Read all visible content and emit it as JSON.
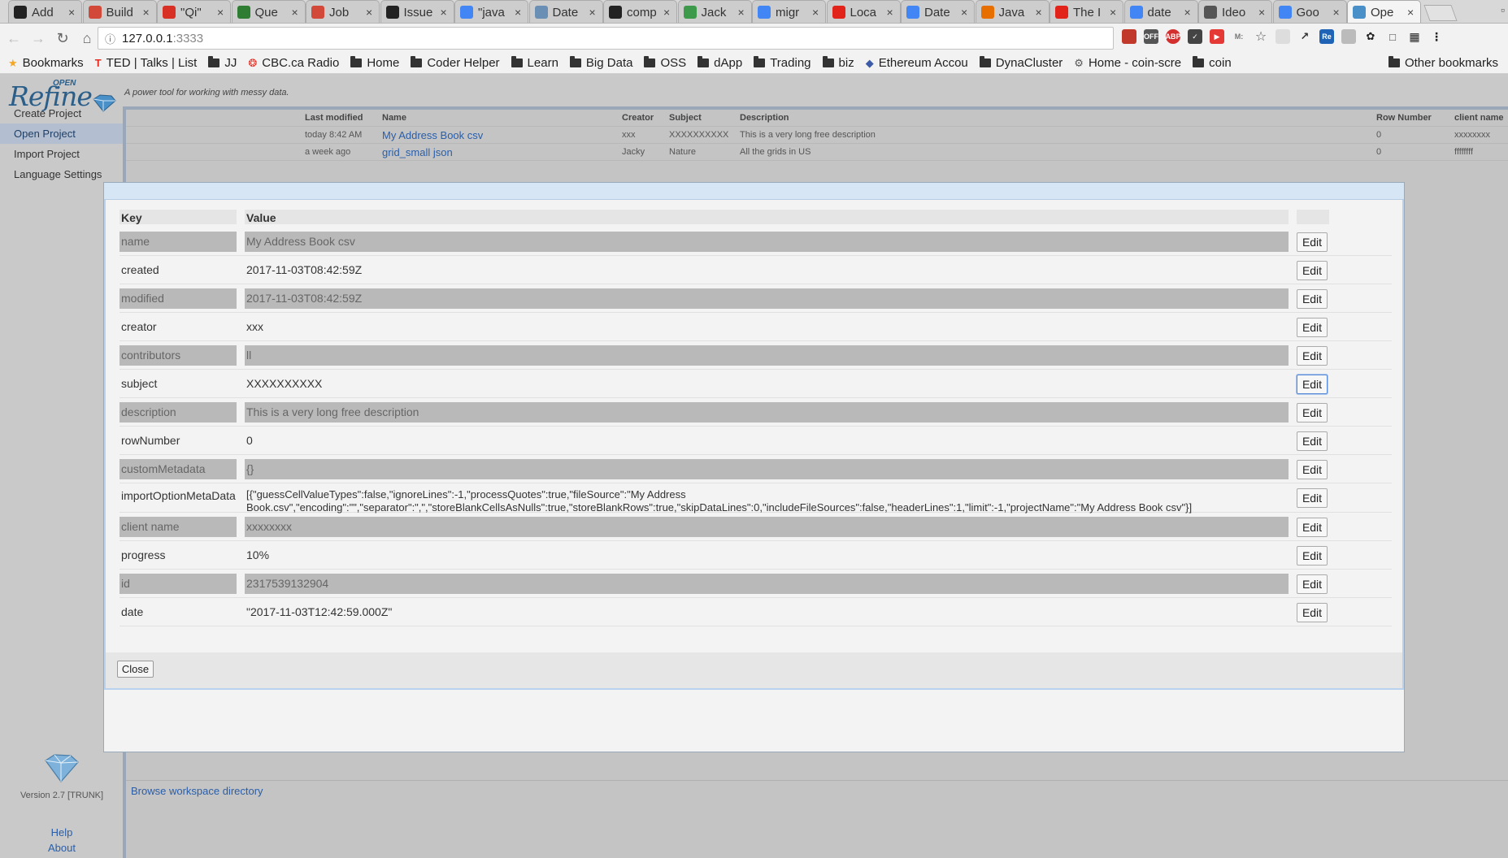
{
  "browser": {
    "tabs": [
      {
        "title": "Add",
        "icon": "github-icon",
        "color": "#222222"
      },
      {
        "title": "Build",
        "icon": "jenkins-icon",
        "color": "#d24939"
      },
      {
        "title": "\"Qi\"",
        "icon": "gmail-icon",
        "color": "#d93025"
      },
      {
        "title": "Que",
        "icon": "sheets-icon",
        "color": "#2e7d32"
      },
      {
        "title": "Job",
        "icon": "jenkins-icon",
        "color": "#d24939"
      },
      {
        "title": "Issue",
        "icon": "github-icon",
        "color": "#222222"
      },
      {
        "title": "\"java",
        "icon": "google-icon",
        "color": "#4285f4"
      },
      {
        "title": "Date",
        "icon": "doc-icon",
        "color": "#6a8fb5"
      },
      {
        "title": "comp",
        "icon": "github-icon",
        "color": "#222222"
      },
      {
        "title": "Jack",
        "icon": "leaf-icon",
        "color": "#3c9a4a"
      },
      {
        "title": "migr",
        "icon": "google-icon",
        "color": "#4285f4"
      },
      {
        "title": "Loca",
        "icon": "oracle-icon",
        "color": "#e2231a"
      },
      {
        "title": "Date",
        "icon": "google-icon",
        "color": "#4285f4"
      },
      {
        "title": "Java",
        "icon": "java-icon",
        "color": "#e76f00"
      },
      {
        "title": "The I",
        "icon": "oracle-icon",
        "color": "#e2231a"
      },
      {
        "title": "date",
        "icon": "google-icon",
        "color": "#4285f4"
      },
      {
        "title": "Ideo",
        "icon": "ideone-icon",
        "color": "#555555"
      },
      {
        "title": "Goo",
        "icon": "google-icon",
        "color": "#4285f4"
      },
      {
        "title": "Ope",
        "icon": "openrefine-icon",
        "color": "#4a90c8",
        "active": true
      }
    ],
    "url_host": "127.0.0.1",
    "url_port": ":3333",
    "bookmarks": [
      {
        "label": "Bookmarks",
        "icon": "star-icon"
      },
      {
        "label": "TED | Talks | List",
        "icon": "ted-icon"
      },
      {
        "label": "JJ",
        "icon": "folder-icon"
      },
      {
        "label": "CBC.ca Radio",
        "icon": "cbc-icon"
      },
      {
        "label": "Home",
        "icon": "folder-icon"
      },
      {
        "label": "Coder Helper",
        "icon": "folder-icon"
      },
      {
        "label": "Learn",
        "icon": "folder-icon"
      },
      {
        "label": "Big Data",
        "icon": "folder-icon"
      },
      {
        "label": "OSS",
        "icon": "folder-icon"
      },
      {
        "label": "dApp",
        "icon": "folder-icon"
      },
      {
        "label": "Trading",
        "icon": "folder-icon"
      },
      {
        "label": "biz",
        "icon": "folder-icon"
      },
      {
        "label": "Ethereum Accou",
        "icon": "ethereum-icon"
      },
      {
        "label": "DynaCluster",
        "icon": "folder-icon"
      },
      {
        "label": "Home - coin-scre",
        "icon": "gear-icon"
      },
      {
        "label": "coin",
        "icon": "folder-icon"
      }
    ],
    "other_bookmarks": "Other bookmarks"
  },
  "app": {
    "logo_open": "OPEN",
    "logo_refine": "Refine",
    "tagline": "A power tool for working with messy data.",
    "nav": [
      {
        "label": "Create Project",
        "selected": false
      },
      {
        "label": "Open Project",
        "selected": true
      },
      {
        "label": "Import Project",
        "selected": false
      },
      {
        "label": "Language Settings",
        "selected": false
      }
    ],
    "version": "Version 2.7 [TRUNK]",
    "help": "Help",
    "about": "About",
    "browse_workspace": "Browse workspace directory"
  },
  "projects": {
    "columns": [
      "Last modified",
      "Name",
      "Creator",
      "Subject",
      "Description",
      "Row Number",
      "client name"
    ],
    "rows": [
      {
        "modified": "today 8:42 AM",
        "name": "My Address Book csv",
        "creator": "xxx",
        "subject": "XXXXXXXXXX",
        "description": "This is a very long free description",
        "row_number": "0",
        "client": "xxxxxxxx"
      },
      {
        "modified": "a week ago",
        "name": "grid_small json",
        "creator": "Jacky",
        "subject": "Nature",
        "description": "All the grids in US",
        "row_number": "0",
        "client": "ffffffff"
      }
    ]
  },
  "dialog": {
    "key_header": "Key",
    "value_header": "Value",
    "edit_label": "Edit",
    "close_label": "Close",
    "rows": [
      {
        "key": "name",
        "value": "My Address Book csv"
      },
      {
        "key": "created",
        "value": "2017-11-03T08:42:59Z"
      },
      {
        "key": "modified",
        "value": "2017-11-03T08:42:59Z"
      },
      {
        "key": "creator",
        "value": "xxx"
      },
      {
        "key": "contributors",
        "value": "ll"
      },
      {
        "key": "subject",
        "value": "XXXXXXXXXX"
      },
      {
        "key": "description",
        "value": "This is a very long free description"
      },
      {
        "key": "rowNumber",
        "value": "0"
      },
      {
        "key": "customMetadata",
        "value": "{}"
      },
      {
        "key": "importOptionMetaData",
        "value": "[{\"guessCellValueTypes\":false,\"ignoreLines\":-1,\"processQuotes\":true,\"fileSource\":\"My Address Book.csv\",\"encoding\":\"\",\"separator\":\",\",\"storeBlankCellsAsNulls\":true,\"storeBlankRows\":true,\"skipDataLines\":0,\"includeFileSources\":false,\"headerLines\":1,\"limit\":-1,\"projectName\":\"My Address Book csv\"}]"
      },
      {
        "key": "client name",
        "value": "xxxxxxxx"
      },
      {
        "key": "progress",
        "value": "10%"
      },
      {
        "key": "id",
        "value": "2317539132904"
      },
      {
        "key": "date",
        "value": "\"2017-11-03T12:42:59.000Z\""
      }
    ]
  }
}
